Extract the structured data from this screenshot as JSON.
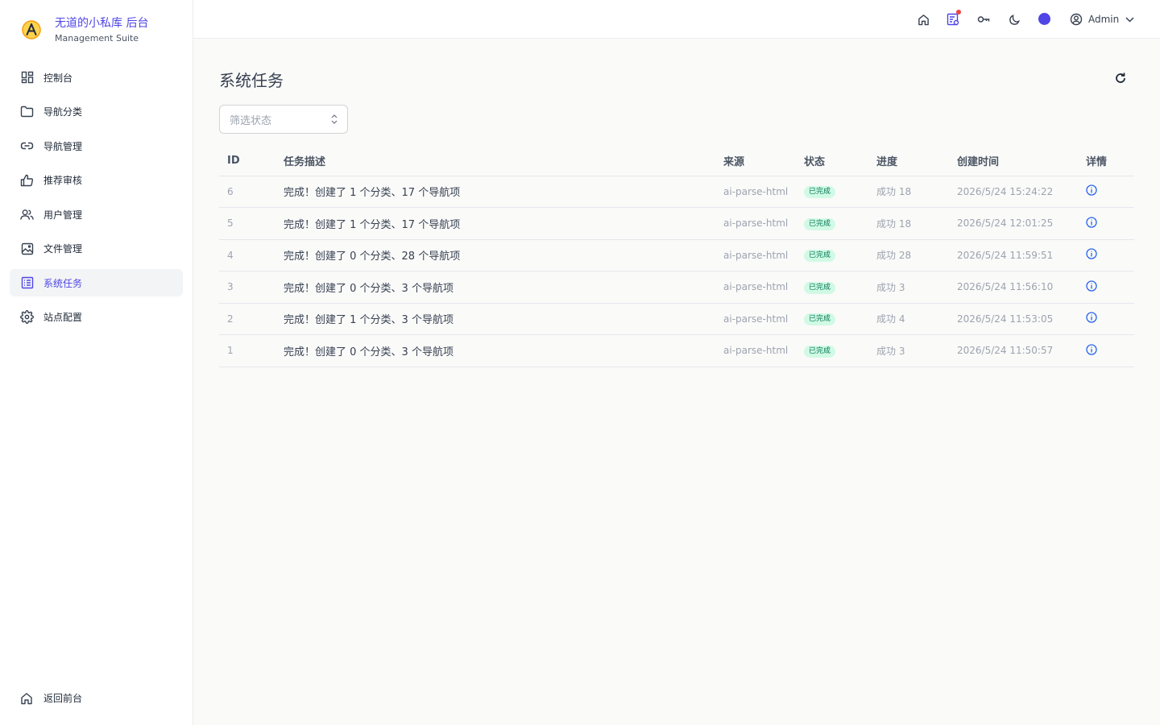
{
  "brand": {
    "title": "无道的小私库 后台",
    "subtitle": "Management Suite"
  },
  "sidebar": {
    "items": [
      {
        "label": "控制台",
        "icon": "dashboard-icon"
      },
      {
        "label": "导航分类",
        "icon": "folder-icon"
      },
      {
        "label": "导航管理",
        "icon": "link-icon"
      },
      {
        "label": "推荐审核",
        "icon": "thumb-up-icon"
      },
      {
        "label": "用户管理",
        "icon": "users-icon"
      },
      {
        "label": "文件管理",
        "icon": "image-icon"
      },
      {
        "label": "系统任务",
        "icon": "task-list-icon",
        "active": true
      },
      {
        "label": "站点配置",
        "icon": "gear-icon"
      }
    ],
    "back_label": "返回前台"
  },
  "topbar": {
    "user_name": "Admin"
  },
  "main": {
    "title": "系统任务",
    "filter_placeholder": "筛选状态"
  },
  "table": {
    "columns": [
      "ID",
      "任务描述",
      "来源",
      "状态",
      "进度",
      "创建时间",
      "详情"
    ],
    "rows": [
      {
        "id": "6",
        "desc": "完成！创建了 1 个分类、17 个导航项",
        "source": "ai-parse-html",
        "status": "已完成",
        "progress": "成功 18",
        "created": "2026/5/24 15:24:22"
      },
      {
        "id": "5",
        "desc": "完成！创建了 1 个分类、17 个导航项",
        "source": "ai-parse-html",
        "status": "已完成",
        "progress": "成功 18",
        "created": "2026/5/24 12:01:25"
      },
      {
        "id": "4",
        "desc": "完成！创建了 0 个分类、28 个导航项",
        "source": "ai-parse-html",
        "status": "已完成",
        "progress": "成功 28",
        "created": "2026/5/24 11:59:51"
      },
      {
        "id": "3",
        "desc": "完成！创建了 0 个分类、3 个导航项",
        "source": "ai-parse-html",
        "status": "已完成",
        "progress": "成功 3",
        "created": "2026/5/24 11:56:10"
      },
      {
        "id": "2",
        "desc": "完成！创建了 1 个分类、3 个导航项",
        "source": "ai-parse-html",
        "status": "已完成",
        "progress": "成功 4",
        "created": "2026/5/24 11:53:05"
      },
      {
        "id": "1",
        "desc": "完成！创建了 0 个分类、3 个导航项",
        "source": "ai-parse-html",
        "status": "已完成",
        "progress": "成功 3",
        "created": "2026/5/24 11:50:57"
      }
    ]
  },
  "colors": {
    "accent": "#4f46e5",
    "badge_bg": "#d1fae5",
    "badge_text": "#047857",
    "notification": "#ef4444"
  }
}
